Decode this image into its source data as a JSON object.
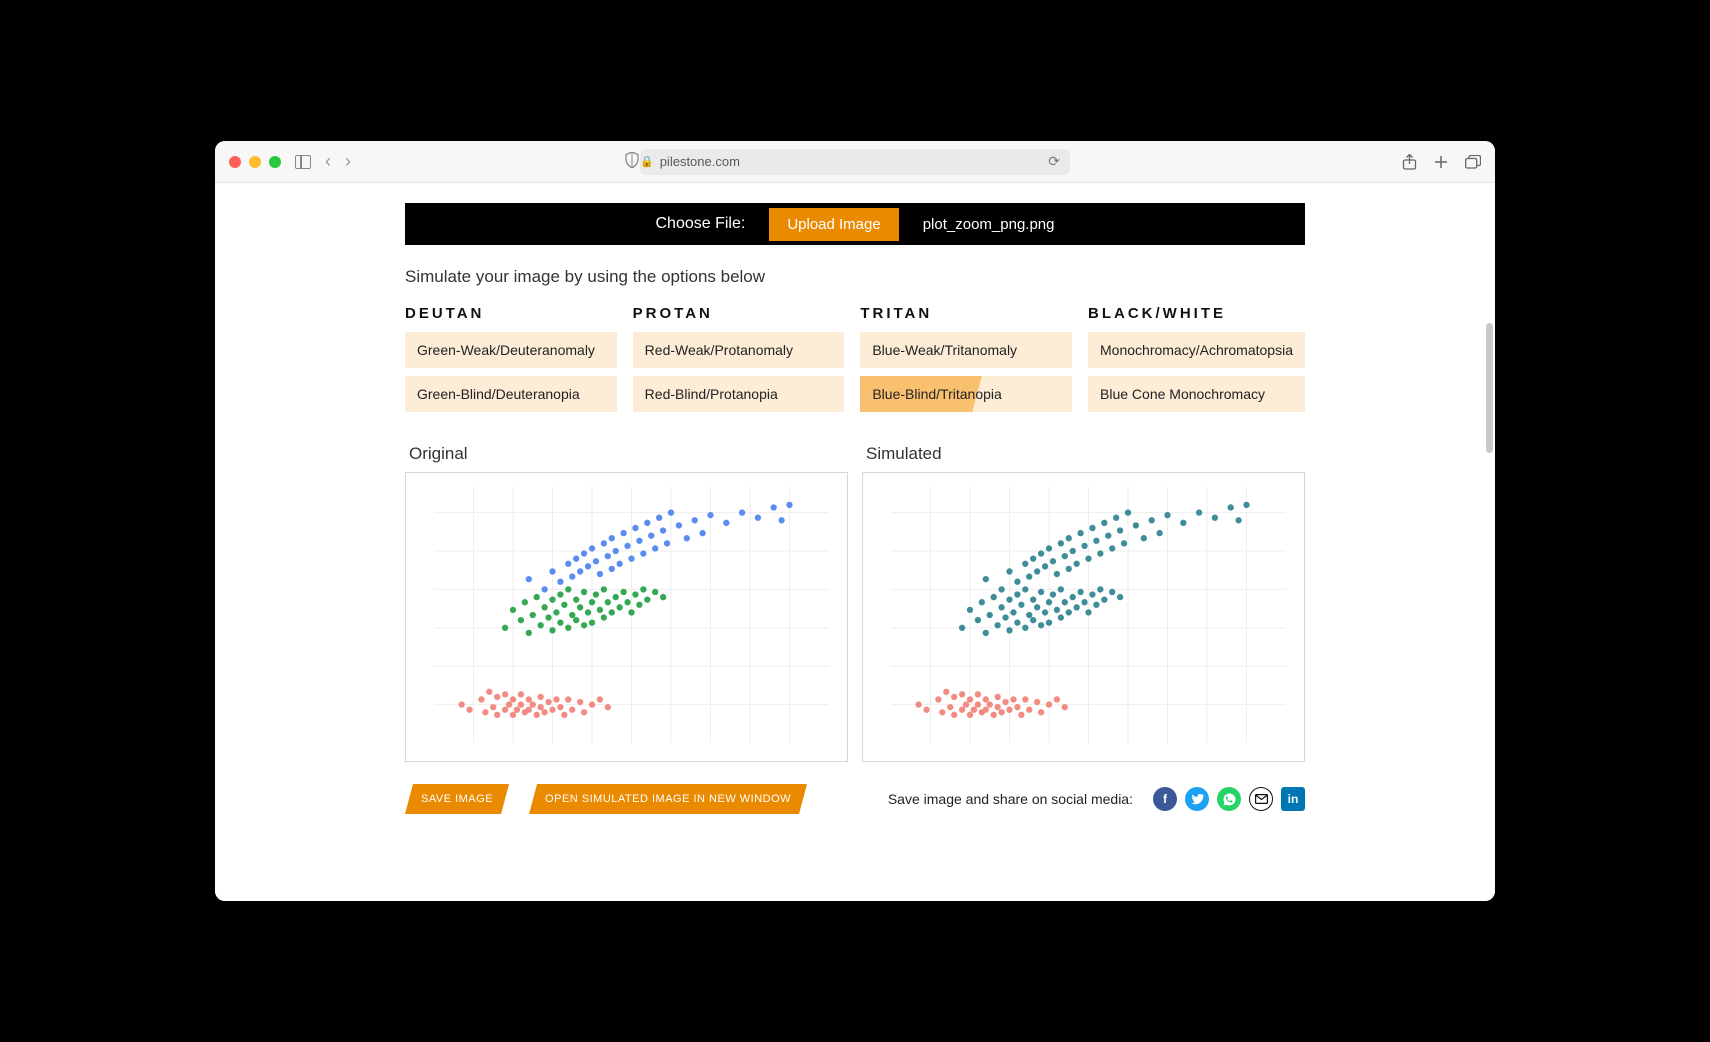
{
  "browser": {
    "url_host": "pilestone.com"
  },
  "choose_bar": {
    "label": "Choose File:",
    "upload_label": "Upload Image",
    "filename": "plot_zoom_png.png"
  },
  "instruction": "Simulate your image by using the options below",
  "categories": [
    {
      "head": "DEUTAN",
      "options": [
        "Green-Weak/Deuteranomaly",
        "Green-Blind/Deuteranopia"
      ]
    },
    {
      "head": "PROTAN",
      "options": [
        "Red-Weak/Protanomaly",
        "Red-Blind/Protanopia"
      ]
    },
    {
      "head": "TRITAN",
      "options": [
        "Blue-Weak/Tritanomaly",
        "Blue-Blind/Tritanopia"
      ]
    },
    {
      "head": "BLACK/WHITE",
      "options": [
        "Monochromacy/Achromatopsia",
        "Blue Cone Monochromacy"
      ]
    }
  ],
  "selected_option": "Blue-Blind/Tritanopia",
  "chart_labels": {
    "original": "Original",
    "simulated": "Simulated"
  },
  "chart_data": [
    {
      "id": "original",
      "type": "scatter",
      "title": "",
      "xlabel": "",
      "ylabel": "",
      "xlim": [
        0,
        100
      ],
      "ylim": [
        0,
        100
      ],
      "x_gridlines": [
        10,
        20,
        30,
        40,
        50,
        60,
        70,
        80,
        90
      ],
      "y_gridlines": [
        15,
        30,
        45,
        60,
        75,
        90
      ],
      "series": [
        {
          "name": "red",
          "color": "#f28b82",
          "points": [
            [
              7,
              15
            ],
            [
              9,
              13
            ],
            [
              12,
              17
            ],
            [
              13,
              12
            ],
            [
              14,
              20
            ],
            [
              15,
              14
            ],
            [
              16,
              11
            ],
            [
              16,
              18
            ],
            [
              18,
              13
            ],
            [
              18,
              19
            ],
            [
              19,
              15
            ],
            [
              20,
              11
            ],
            [
              20,
              17
            ],
            [
              21,
              13
            ],
            [
              22,
              19
            ],
            [
              22,
              15
            ],
            [
              23,
              12
            ],
            [
              24,
              17
            ],
            [
              24,
              13
            ],
            [
              25,
              15
            ],
            [
              26,
              11
            ],
            [
              27,
              18
            ],
            [
              27,
              14
            ],
            [
              28,
              12
            ],
            [
              29,
              16
            ],
            [
              30,
              13
            ],
            [
              31,
              17
            ],
            [
              32,
              14
            ],
            [
              33,
              11
            ],
            [
              34,
              17
            ],
            [
              35,
              13
            ],
            [
              37,
              16
            ],
            [
              38,
              12
            ],
            [
              40,
              15
            ],
            [
              42,
              17
            ],
            [
              44,
              14
            ]
          ]
        },
        {
          "name": "green",
          "color": "#34a853",
          "points": [
            [
              18,
              45
            ],
            [
              20,
              52
            ],
            [
              22,
              48
            ],
            [
              23,
              55
            ],
            [
              24,
              43
            ],
            [
              25,
              50
            ],
            [
              26,
              57
            ],
            [
              27,
              46
            ],
            [
              28,
              53
            ],
            [
              29,
              49
            ],
            [
              30,
              56
            ],
            [
              30,
              44
            ],
            [
              31,
              51
            ],
            [
              32,
              47
            ],
            [
              32,
              58
            ],
            [
              33,
              54
            ],
            [
              34,
              45
            ],
            [
              34,
              60
            ],
            [
              35,
              50
            ],
            [
              36,
              56
            ],
            [
              36,
              48
            ],
            [
              37,
              53
            ],
            [
              38,
              46
            ],
            [
              38,
              59
            ],
            [
              39,
              51
            ],
            [
              40,
              55
            ],
            [
              40,
              47
            ],
            [
              41,
              58
            ],
            [
              42,
              52
            ],
            [
              43,
              49
            ],
            [
              43,
              60
            ],
            [
              44,
              55
            ],
            [
              45,
              51
            ],
            [
              46,
              57
            ],
            [
              47,
              53
            ],
            [
              48,
              59
            ],
            [
              49,
              55
            ],
            [
              50,
              51
            ],
            [
              51,
              58
            ],
            [
              52,
              54
            ],
            [
              53,
              60
            ],
            [
              54,
              56
            ],
            [
              56,
              59
            ],
            [
              58,
              57
            ]
          ]
        },
        {
          "name": "blue",
          "color": "#5b8def",
          "points": [
            [
              24,
              64
            ],
            [
              28,
              60
            ],
            [
              30,
              67
            ],
            [
              32,
              63
            ],
            [
              34,
              70
            ],
            [
              35,
              65
            ],
            [
              36,
              72
            ],
            [
              37,
              67
            ],
            [
              38,
              74
            ],
            [
              39,
              69
            ],
            [
              40,
              76
            ],
            [
              41,
              71
            ],
            [
              42,
              66
            ],
            [
              43,
              78
            ],
            [
              44,
              73
            ],
            [
              45,
              68
            ],
            [
              45,
              80
            ],
            [
              46,
              75
            ],
            [
              47,
              70
            ],
            [
              48,
              82
            ],
            [
              49,
              77
            ],
            [
              50,
              72
            ],
            [
              51,
              84
            ],
            [
              52,
              79
            ],
            [
              53,
              74
            ],
            [
              54,
              86
            ],
            [
              55,
              81
            ],
            [
              56,
              76
            ],
            [
              57,
              88
            ],
            [
              58,
              83
            ],
            [
              59,
              78
            ],
            [
              60,
              90
            ],
            [
              62,
              85
            ],
            [
              64,
              80
            ],
            [
              66,
              87
            ],
            [
              68,
              82
            ],
            [
              70,
              89
            ],
            [
              74,
              86
            ],
            [
              78,
              90
            ],
            [
              82,
              88
            ],
            [
              86,
              92
            ],
            [
              88,
              87
            ],
            [
              90,
              93
            ]
          ]
        }
      ]
    },
    {
      "id": "simulated",
      "type": "scatter",
      "title": "",
      "xlabel": "",
      "ylabel": "",
      "xlim": [
        0,
        100
      ],
      "ylim": [
        0,
        100
      ],
      "x_gridlines": [
        10,
        20,
        30,
        40,
        50,
        60,
        70,
        80,
        90
      ],
      "y_gridlines": [
        15,
        30,
        45,
        60,
        75,
        90
      ],
      "series": [
        {
          "name": "red-sim",
          "color": "#f28b82",
          "points": [
            [
              7,
              15
            ],
            [
              9,
              13
            ],
            [
              12,
              17
            ],
            [
              13,
              12
            ],
            [
              14,
              20
            ],
            [
              15,
              14
            ],
            [
              16,
              11
            ],
            [
              16,
              18
            ],
            [
              18,
              13
            ],
            [
              18,
              19
            ],
            [
              19,
              15
            ],
            [
              20,
              11
            ],
            [
              20,
              17
            ],
            [
              21,
              13
            ],
            [
              22,
              19
            ],
            [
              22,
              15
            ],
            [
              23,
              12
            ],
            [
              24,
              17
            ],
            [
              24,
              13
            ],
            [
              25,
              15
            ],
            [
              26,
              11
            ],
            [
              27,
              18
            ],
            [
              27,
              14
            ],
            [
              28,
              12
            ],
            [
              29,
              16
            ],
            [
              30,
              13
            ],
            [
              31,
              17
            ],
            [
              32,
              14
            ],
            [
              33,
              11
            ],
            [
              34,
              17
            ],
            [
              35,
              13
            ],
            [
              37,
              16
            ],
            [
              38,
              12
            ],
            [
              40,
              15
            ],
            [
              42,
              17
            ],
            [
              44,
              14
            ]
          ]
        },
        {
          "name": "teal-merged",
          "color": "#3f8d99",
          "points": [
            [
              18,
              45
            ],
            [
              20,
              52
            ],
            [
              22,
              48
            ],
            [
              23,
              55
            ],
            [
              24,
              43
            ],
            [
              25,
              50
            ],
            [
              26,
              57
            ],
            [
              27,
              46
            ],
            [
              28,
              53
            ],
            [
              29,
              49
            ],
            [
              30,
              56
            ],
            [
              30,
              44
            ],
            [
              31,
              51
            ],
            [
              32,
              47
            ],
            [
              32,
              58
            ],
            [
              33,
              54
            ],
            [
              34,
              45
            ],
            [
              34,
              60
            ],
            [
              35,
              50
            ],
            [
              36,
              56
            ],
            [
              36,
              48
            ],
            [
              37,
              53
            ],
            [
              38,
              46
            ],
            [
              38,
              59
            ],
            [
              39,
              51
            ],
            [
              40,
              55
            ],
            [
              40,
              47
            ],
            [
              41,
              58
            ],
            [
              42,
              52
            ],
            [
              43,
              49
            ],
            [
              43,
              60
            ],
            [
              44,
              55
            ],
            [
              45,
              51
            ],
            [
              46,
              57
            ],
            [
              47,
              53
            ],
            [
              48,
              59
            ],
            [
              49,
              55
            ],
            [
              50,
              51
            ],
            [
              51,
              58
            ],
            [
              52,
              54
            ],
            [
              53,
              60
            ],
            [
              54,
              56
            ],
            [
              56,
              59
            ],
            [
              58,
              57
            ],
            [
              24,
              64
            ],
            [
              28,
              60
            ],
            [
              30,
              67
            ],
            [
              32,
              63
            ],
            [
              34,
              70
            ],
            [
              35,
              65
            ],
            [
              36,
              72
            ],
            [
              37,
              67
            ],
            [
              38,
              74
            ],
            [
              39,
              69
            ],
            [
              40,
              76
            ],
            [
              41,
              71
            ],
            [
              42,
              66
            ],
            [
              43,
              78
            ],
            [
              44,
              73
            ],
            [
              45,
              68
            ],
            [
              45,
              80
            ],
            [
              46,
              75
            ],
            [
              47,
              70
            ],
            [
              48,
              82
            ],
            [
              49,
              77
            ],
            [
              50,
              72
            ],
            [
              51,
              84
            ],
            [
              52,
              79
            ],
            [
              53,
              74
            ],
            [
              54,
              86
            ],
            [
              55,
              81
            ],
            [
              56,
              76
            ],
            [
              57,
              88
            ],
            [
              58,
              83
            ],
            [
              59,
              78
            ],
            [
              60,
              90
            ],
            [
              62,
              85
            ],
            [
              64,
              80
            ],
            [
              66,
              87
            ],
            [
              68,
              82
            ],
            [
              70,
              89
            ],
            [
              74,
              86
            ],
            [
              78,
              90
            ],
            [
              82,
              88
            ],
            [
              86,
              92
            ],
            [
              88,
              87
            ],
            [
              90,
              93
            ]
          ]
        }
      ]
    }
  ],
  "actions": {
    "save": "SAVE IMAGE",
    "open": "OPEN SIMULATED IMAGE IN NEW WINDOW"
  },
  "share_text": "Save image and share on social media:"
}
